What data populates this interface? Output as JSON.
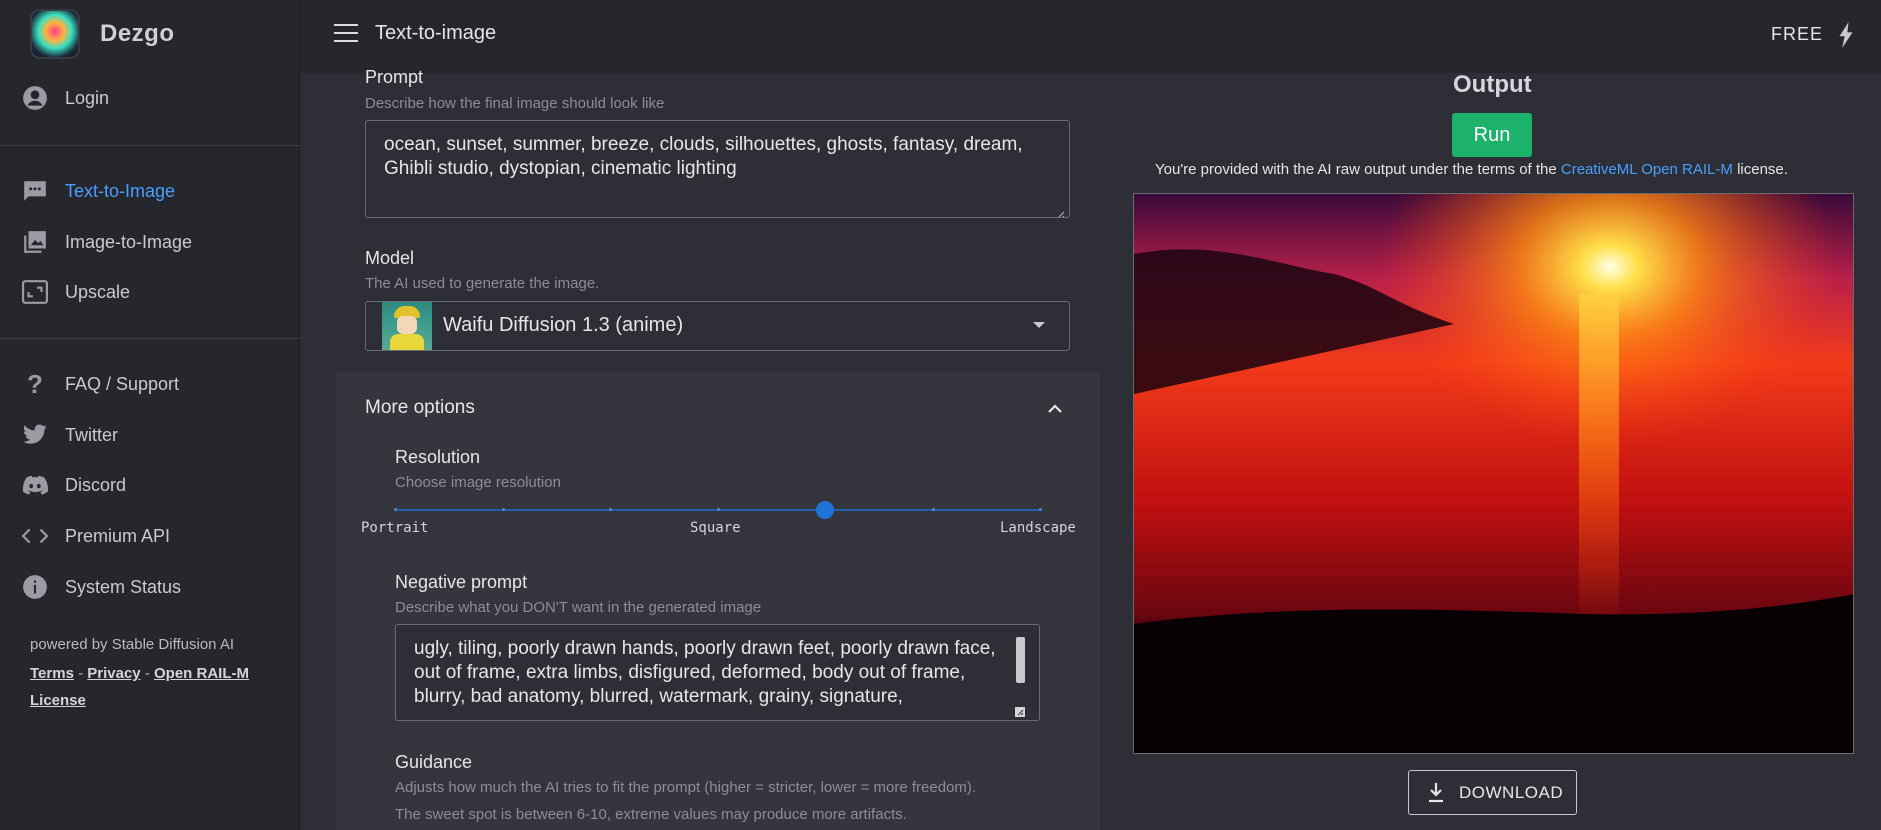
{
  "app": {
    "name": "Dezgo"
  },
  "topbar": {
    "title": "Text-to-image",
    "plan": "FREE"
  },
  "sidebar": {
    "login": "Login",
    "items": [
      {
        "label": "Text-to-Image",
        "icon": "chat-bubble-icon",
        "active": true
      },
      {
        "label": "Image-to-Image",
        "icon": "images-icon",
        "active": false
      },
      {
        "label": "Upscale",
        "icon": "resize-icon",
        "active": false
      }
    ],
    "links": [
      {
        "label": "FAQ / Support",
        "icon": "question-icon"
      },
      {
        "label": "Twitter",
        "icon": "twitter-icon"
      },
      {
        "label": "Discord",
        "icon": "discord-icon"
      },
      {
        "label": "Premium API",
        "icon": "code-icon"
      },
      {
        "label": "System Status",
        "icon": "info-icon"
      }
    ],
    "footer": {
      "powered": "powered by Stable Diffusion AI",
      "terms": "Terms",
      "privacy": "Privacy",
      "license": "Open RAIL-M License",
      "sep": "-"
    }
  },
  "form": {
    "prompt": {
      "label": "Prompt",
      "hint": "Describe how the final image should look like",
      "value": "ocean, sunset, summer, breeze, clouds, silhouettes, ghosts, fantasy, dream, Ghibli studio, dystopian, cinematic lighting"
    },
    "model": {
      "label": "Model",
      "hint": "The AI used to generate the image.",
      "value": "Waifu Diffusion 1.3 (anime)"
    },
    "more_options": "More options",
    "resolution": {
      "label": "Resolution",
      "hint": "Choose image resolution",
      "marks": [
        "Portrait",
        "Square",
        "Landscape"
      ],
      "steps": 7,
      "selected_index": 4
    },
    "negative": {
      "label": "Negative prompt",
      "hint": "Describe what you DON'T want in the generated image",
      "value": "ugly, tiling, poorly drawn hands, poorly drawn feet, poorly drawn face, out of frame, extra limbs, disfigured, deformed, body out of frame, blurry, bad anatomy, blurred, watermark, grainy, signature,"
    },
    "guidance": {
      "label": "Guidance",
      "hint1": "Adjusts how much the AI tries to fit the prompt (higher = stricter, lower = more freedom).",
      "hint2": "The sweet spot is between 6-10, extreme values may produce more artifacts."
    }
  },
  "output": {
    "title": "Output",
    "run": "Run",
    "license_prefix": "You're provided with the AI raw output under the terms of the ",
    "license_link": "CreativeML Open RAIL-M",
    "license_suffix": " license.",
    "download": "DOWNLOAD"
  },
  "colors": {
    "accent": "#4a9eff",
    "run": "#1db26b",
    "slider": "#1f73d6"
  }
}
